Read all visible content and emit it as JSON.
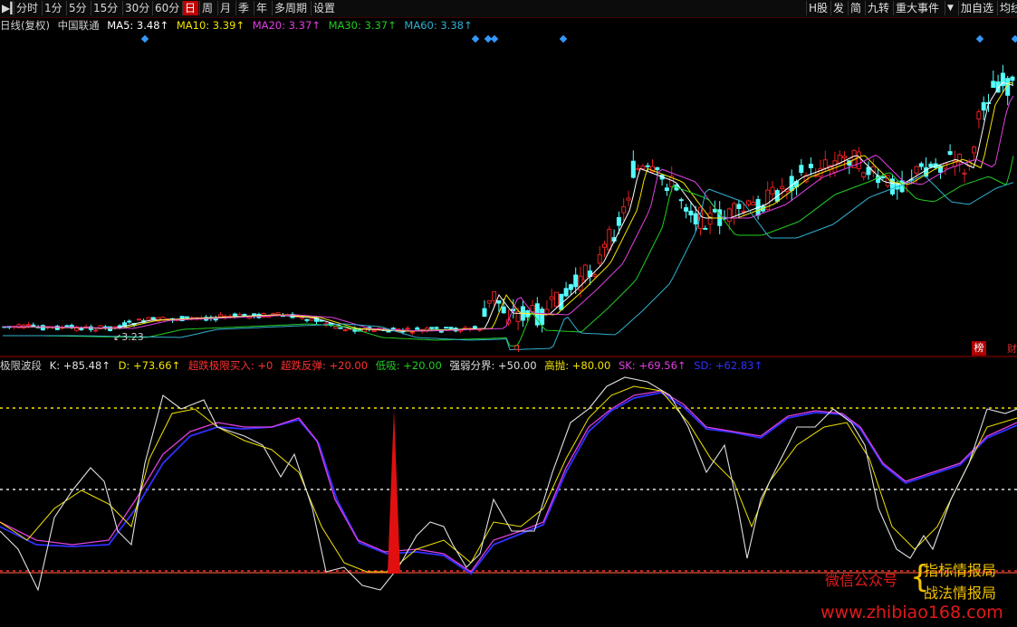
{
  "toolbar": {
    "play_icon": "play-icon",
    "periods": [
      "分时",
      "1分",
      "5分",
      "15分",
      "30分",
      "60分",
      "日",
      "周",
      "月",
      "季",
      "年",
      "多周期",
      "设置"
    ],
    "active_period": "日",
    "right_items": [
      "H股",
      "发",
      "简",
      "九转",
      "重大事件",
      "▼",
      "加自选",
      "均线"
    ]
  },
  "main_chart": {
    "series_label": "日线(复权)",
    "stock_name": "中国联通",
    "ma_values": [
      {
        "label": "MA5: 3.48↑",
        "color": "#ffffff"
      },
      {
        "label": "MA10: 3.39↑",
        "color": "#f2e400"
      },
      {
        "label": "MA20: 3.37↑",
        "color": "#e040e0"
      },
      {
        "label": "MA30: 3.37↑",
        "color": "#22cc22"
      },
      {
        "label": "MA60: 3.38↑",
        "color": "#30b0d0"
      }
    ],
    "low_label": "3.23",
    "tag_q": "q",
    "tag_bang": "榜",
    "tag_cai": "财",
    "up_color": "#e02020",
    "down_color": "#54ffff",
    "diamond_color": "#3399ff"
  },
  "indicator": {
    "title": "极限波段",
    "values": [
      {
        "label": "K: +85.48↑",
        "color": "#e0e0e0"
      },
      {
        "label": "D: +73.66↑",
        "color": "#f2e400"
      },
      {
        "label": "超跌极限买入: +0",
        "color": "#ff3030"
      },
      {
        "label": "超跌反弹: +20.00",
        "color": "#ff3030"
      },
      {
        "label": "低吸: +20.00",
        "color": "#22cc22"
      },
      {
        "label": "强弱分界: +50.00",
        "color": "#e0e0e0"
      },
      {
        "label": "高抛: +80.00",
        "color": "#f2e400"
      },
      {
        "label": "SK: +69.56↑",
        "color": "#e040e0"
      },
      {
        "label": "SD: +62.83↑",
        "color": "#3030ff"
      }
    ]
  },
  "watermark": {
    "wechat": "微信公众号",
    "name1": "指标情报局",
    "name2": "战法情报局",
    "url": "www.zhibiao168.com"
  }
}
